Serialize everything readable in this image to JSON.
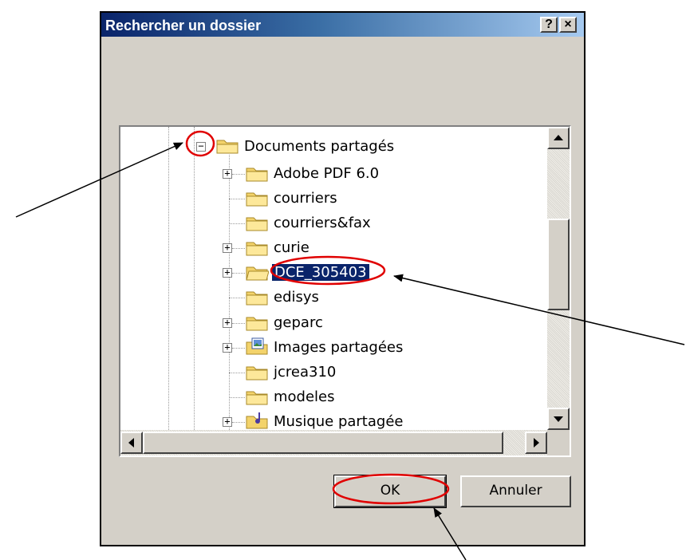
{
  "dialog": {
    "title": "Rechercher un dossier",
    "help_label": "?",
    "close_label": "×",
    "ok_label": "OK",
    "cancel_label": "Annuler"
  },
  "tree": {
    "root": {
      "label": "Documents partagés",
      "expander": "−"
    },
    "items": [
      {
        "label": "Adobe PDF 6.0",
        "expander": "+"
      },
      {
        "label": "courriers",
        "expander": ""
      },
      {
        "label": "courriers&fax",
        "expander": ""
      },
      {
        "label": "curie",
        "expander": "+"
      },
      {
        "label": "DCE_305403",
        "expander": "+",
        "selected": true
      },
      {
        "label": "edisys",
        "expander": ""
      },
      {
        "label": "geparc",
        "expander": "+"
      },
      {
        "label": "Images partagées",
        "expander": "+",
        "icon": "shared-pictures-folder-icon"
      },
      {
        "label": "jcrea310",
        "expander": ""
      },
      {
        "label": "modeles",
        "expander": ""
      },
      {
        "label": "Musique partagée",
        "expander": "+",
        "icon": "shared-music-folder-icon"
      }
    ]
  },
  "annotation": {
    "color": "#e00000"
  },
  "colors": {
    "title_start": "#0a246a",
    "title_end": "#a6caf0",
    "face": "#d4d0c8",
    "selection": "#0a246a"
  }
}
